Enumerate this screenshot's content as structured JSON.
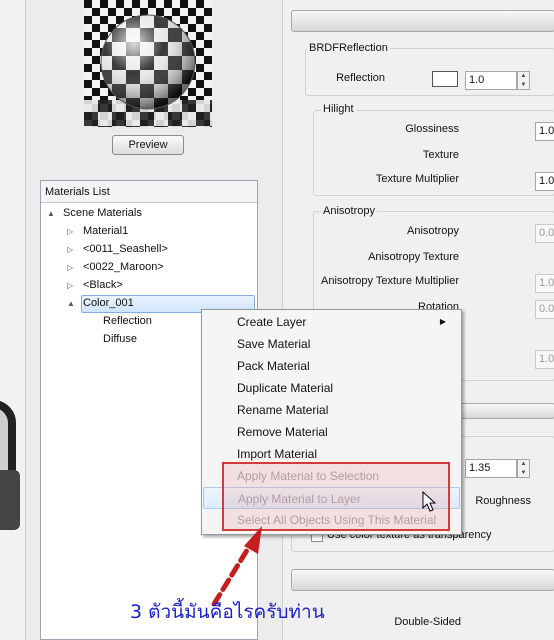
{
  "preview": {
    "button_label": "Preview"
  },
  "materials_list": {
    "header": "Materials List",
    "items": [
      {
        "label": "Scene Materials",
        "expander": "▲"
      },
      {
        "label": "Material1",
        "expander": "▷"
      },
      {
        "label": "<0011_Seashell>",
        "expander": "▷"
      },
      {
        "label": "<0022_Maroon>",
        "expander": "▷"
      },
      {
        "label": "<Black>",
        "expander": "▷"
      },
      {
        "label": "Color_001",
        "expander": "▲"
      },
      {
        "label": "Reflection"
      },
      {
        "label": "Diffuse"
      }
    ]
  },
  "properties": {
    "brdf_title": "BRDFReflection",
    "reflection_label": "Reflection",
    "reflection_value": "1.0",
    "hilight_title": "Hilight",
    "glossiness_label": "Glossiness",
    "glossiness_value": "1.0",
    "texture_label": "Texture",
    "texture_multiplier_label": "Texture Multiplier",
    "texture_multiplier_value": "1.0",
    "anisotropy_title": "Anisotropy",
    "anisotropy_label": "Anisotropy",
    "anisotropy_value": "0.0",
    "anisotropy_texture_label": "Anisotropy Texture",
    "anisotropy_texture_multiplier_label": "Anisotropy Texture Multiplier",
    "anisotropy_texture_multiplier_value": "1.0",
    "rotation_label": "Rotation",
    "rotation_value": "0.0",
    "hidden_value": "1.0",
    "ior_value": "1.35",
    "roughness_label": "Roughness",
    "transparency_label": "Use color texture as transparency",
    "double_sided_label": "Double-Sided"
  },
  "context_menu": {
    "items": [
      {
        "label": "Create Layer",
        "has_submenu": true
      },
      {
        "label": "Save Material"
      },
      {
        "label": "Pack Material"
      },
      {
        "label": "Duplicate Material"
      },
      {
        "label": "Rename Material"
      },
      {
        "label": "Remove Material"
      },
      {
        "label": "Import Material"
      },
      {
        "label": "Apply Material to Selection",
        "disabled": true
      },
      {
        "label": "Apply Material to Layer",
        "disabled": true
      },
      {
        "label": "Select All Objects Using This Material",
        "disabled": true
      }
    ]
  },
  "annotation": {
    "text": "3 ตัวนี้มันคือไรครับท่าน",
    "color": "#1a22c8",
    "arrow_color": "#c41e1e",
    "box_color": "#d53a3a"
  },
  "colors": {
    "selection": "#cfe4fa",
    "panel_bg": "#f0f0f0"
  }
}
